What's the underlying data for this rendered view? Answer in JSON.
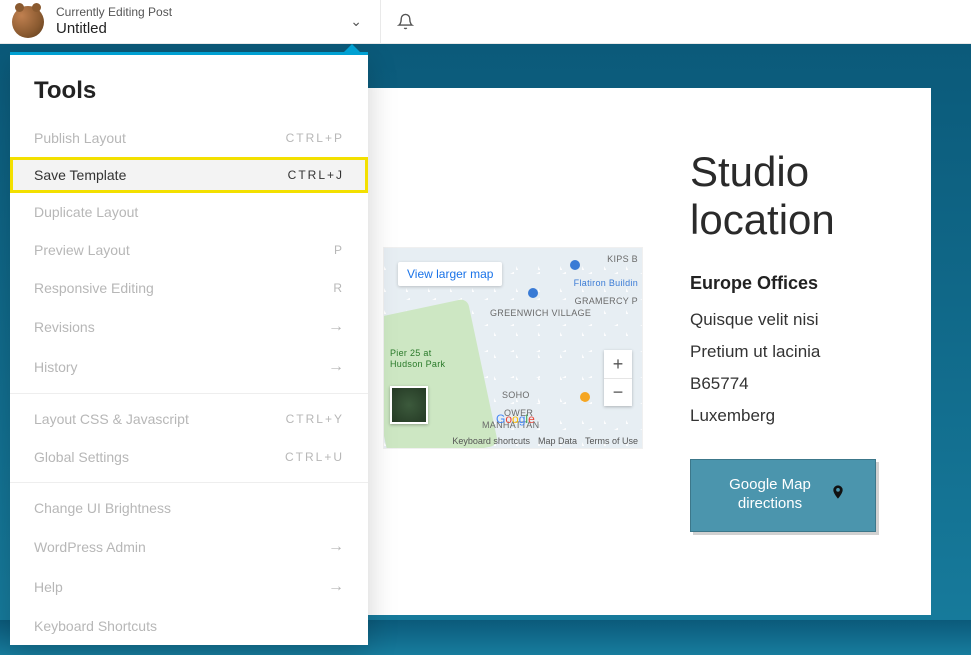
{
  "topbar": {
    "editing_label": "Currently Editing Post",
    "post_title": "Untitled"
  },
  "tools": {
    "header": "Tools",
    "items": [
      {
        "label": "Publish Layout",
        "shortcut": "CTRL+P",
        "type": "shortcut"
      },
      {
        "label": "Save Template",
        "shortcut": "CTRL+J",
        "type": "shortcut",
        "highlight": true
      },
      {
        "label": "Duplicate Layout",
        "shortcut": "",
        "type": "plain"
      },
      {
        "label": "Preview Layout",
        "shortcut": "P",
        "type": "shortcut"
      },
      {
        "label": "Responsive Editing",
        "shortcut": "R",
        "type": "shortcut"
      },
      {
        "label": "Revisions",
        "shortcut": "→",
        "type": "arrow"
      },
      {
        "label": "History",
        "shortcut": "→",
        "type": "arrow"
      }
    ],
    "items2": [
      {
        "label": "Layout CSS & Javascript",
        "shortcut": "CTRL+Y",
        "type": "shortcut"
      },
      {
        "label": "Global Settings",
        "shortcut": "CTRL+U",
        "type": "shortcut"
      }
    ],
    "items3": [
      {
        "label": "Change UI Brightness",
        "shortcut": "",
        "type": "plain"
      },
      {
        "label": "WordPress Admin",
        "shortcut": "→",
        "type": "arrow"
      },
      {
        "label": "Help",
        "shortcut": "→",
        "type": "arrow"
      },
      {
        "label": "Keyboard Shortcuts",
        "shortcut": "",
        "type": "plain"
      }
    ]
  },
  "map": {
    "view_larger": "View larger map",
    "labels": {
      "kips_bay": "KIPS B",
      "flatiron": "Flatiron Buildin",
      "gramercy": "GRAMERCY P",
      "greenwich": "GREENWICH VILLAGE",
      "pier25": "Pier 25 at Hudson Park",
      "soho": "SOHO",
      "ower": "OWER",
      "manhattan": "MANHATTAN"
    },
    "footer": {
      "shortcuts": "Keyboard shortcuts",
      "mapdata": "Map Data",
      "terms": "Terms of Use"
    }
  },
  "location": {
    "heading": "Studio location",
    "subheading": "Europe Offices",
    "line1": "Quisque velit nisi",
    "line2": "Pretium ut lacinia",
    "line3": "B65774",
    "line4": "Luxemberg",
    "cta": "Google Map directions"
  }
}
